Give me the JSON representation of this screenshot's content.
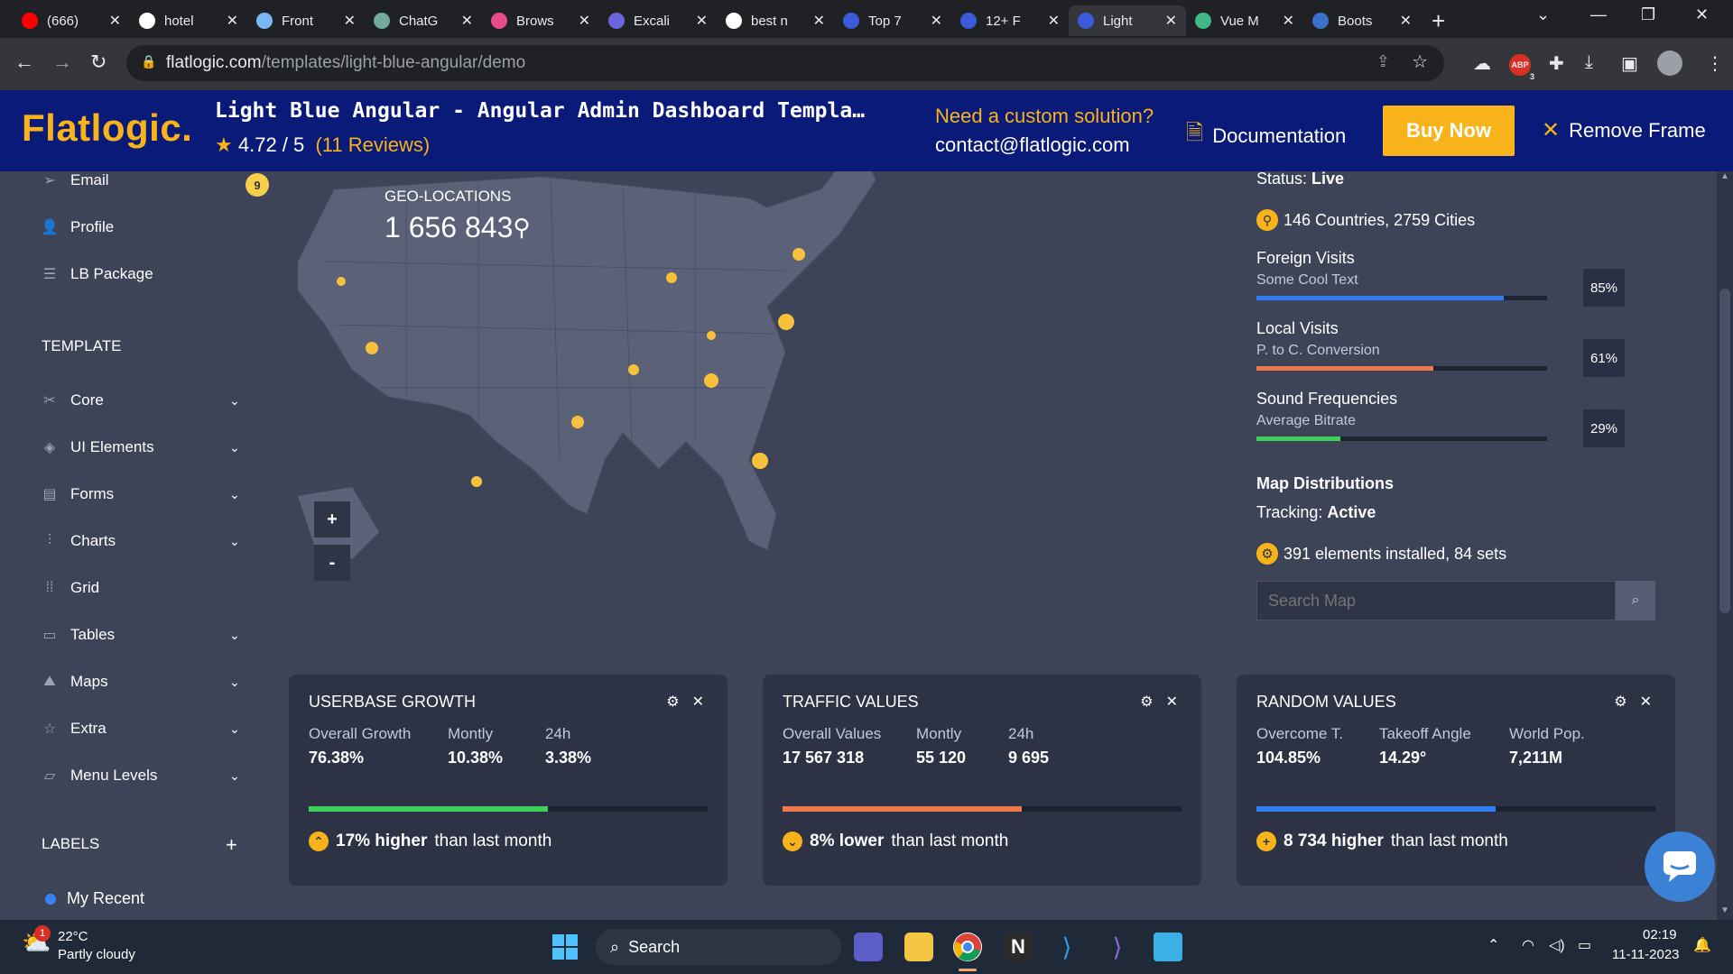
{
  "browser": {
    "tabs": [
      {
        "label": "(666)",
        "color": "#ff0000"
      },
      {
        "label": "hotel",
        "color": "#ffffff"
      },
      {
        "label": "Front",
        "color": "#7ab8f5"
      },
      {
        "label": "ChatG",
        "color": "#74aa9c"
      },
      {
        "label": "Brows",
        "color": "#ea4c89"
      },
      {
        "label": "Excali",
        "color": "#6965db"
      },
      {
        "label": "best n",
        "color": "#ffffff"
      },
      {
        "label": "Top 7",
        "color": "#3b5bdb"
      },
      {
        "label": "12+ F",
        "color": "#3b5bdb"
      },
      {
        "label": "Light",
        "color": "#3b5bdb"
      },
      {
        "label": "Vue M",
        "color": "#41b883"
      },
      {
        "label": "Boots",
        "color": "#3b71ca"
      }
    ],
    "active_tab_index": 9,
    "url_host": "flatlogic.com",
    "url_path": "/templates/light-blue-angular/demo",
    "abp_badge": "3"
  },
  "promo": {
    "logo": "Flatlogic.",
    "title": "Light Blue Angular - Angular Admin Dashboard Templa…",
    "rating_value": "4.72 / 5",
    "rating_reviews": "(11 Reviews)",
    "custom_solution": "Need a custom solution?",
    "contact": "contact@flatlogic.com",
    "documentation": "Documentation",
    "buy_now": "Buy  Now",
    "remove_frame": "Remove Frame"
  },
  "sidebar": {
    "top_items": [
      {
        "label": "Email",
        "icon": "send-icon",
        "badge": "9"
      },
      {
        "label": "Profile",
        "icon": "user-icon"
      },
      {
        "label": "LB Package",
        "icon": "database-icon"
      }
    ],
    "template_heading": "TEMPLATE",
    "template_items": [
      {
        "label": "Core",
        "icon": "tools-icon"
      },
      {
        "label": "UI Elements",
        "icon": "layers-icon"
      },
      {
        "label": "Forms",
        "icon": "form-icon"
      },
      {
        "label": "Charts",
        "icon": "chart-icon"
      },
      {
        "label": "Grid",
        "icon": "grid-icon"
      },
      {
        "label": "Tables",
        "icon": "table-icon"
      },
      {
        "label": "Maps",
        "icon": "map-icon"
      },
      {
        "label": "Extra",
        "icon": "star-icon"
      },
      {
        "label": "Menu Levels",
        "icon": "folder-icon"
      }
    ],
    "labels_heading": "LABELS",
    "labels": [
      {
        "label": "My Recent",
        "color": "#3b82f6"
      }
    ]
  },
  "map": {
    "geo_label": "GEO-LOCATIONS",
    "geo_count": "1 656 843",
    "zoom_in": "+",
    "zoom_out": "-"
  },
  "stats": {
    "status_label": "Status:",
    "status_value": "Live",
    "countries": "146 Countries, 2759 Cities",
    "bars": [
      {
        "title": "Foreign Visits",
        "subtitle": "Some Cool Text",
        "percent": "85%",
        "fraction": 0.85,
        "color": "#2f7df0"
      },
      {
        "title": "Local Visits",
        "subtitle": "P. to C. Conversion",
        "percent": "61%",
        "fraction": 0.61,
        "color": "#f0784f"
      },
      {
        "title": "Sound Frequencies",
        "subtitle": "Average Bitrate",
        "percent": "29%",
        "fraction": 0.29,
        "color": "#3ecf5a"
      }
    ],
    "map_dist": "Map Distributions",
    "tracking_label": "Tracking:",
    "tracking_value": "Active",
    "elements": "391 elements installed, 84 sets",
    "search_placeholder": "Search Map"
  },
  "widgets": [
    {
      "title": "USERBASE GROWTH",
      "stats": [
        {
          "label": "Overall Growth",
          "value": "76.38%"
        },
        {
          "label": "Montly",
          "value": "10.38%"
        },
        {
          "label": "24h",
          "value": "3.38%"
        }
      ],
      "progress": 0.6,
      "color": "#3ecf5a",
      "foot_bold": "17% higher",
      "foot_rest": "than last month",
      "foot_icon": "chevron-up-icon",
      "foot_glyph": "⌃"
    },
    {
      "title": "TRAFFIC VALUES",
      "stats": [
        {
          "label": "Overall Values",
          "value": "17 567 318"
        },
        {
          "label": "Montly",
          "value": "55 120"
        },
        {
          "label": "24h",
          "value": "9 695"
        }
      ],
      "progress": 0.6,
      "color": "#f0784f",
      "foot_bold": "8% lower",
      "foot_rest": "than last month",
      "foot_icon": "chevron-down-icon",
      "foot_glyph": "⌄"
    },
    {
      "title": "RANDOM VALUES",
      "stats": [
        {
          "label": "Overcome T.",
          "value": "104.85%"
        },
        {
          "label": "Takeoff Angle",
          "value": "14.29°"
        },
        {
          "label": "World Pop.",
          "value": "7,211M"
        }
      ],
      "progress": 0.6,
      "color": "#2f7df0",
      "foot_bold": "8 734 higher",
      "foot_rest": "than last month",
      "foot_icon": "plus-icon",
      "foot_glyph": "+"
    }
  ],
  "taskbar": {
    "weather_temp": "22°C",
    "weather_desc": "Partly cloudy",
    "weather_badge": "1",
    "search": "Search",
    "time": "02:19",
    "date": "11-11-2023"
  }
}
